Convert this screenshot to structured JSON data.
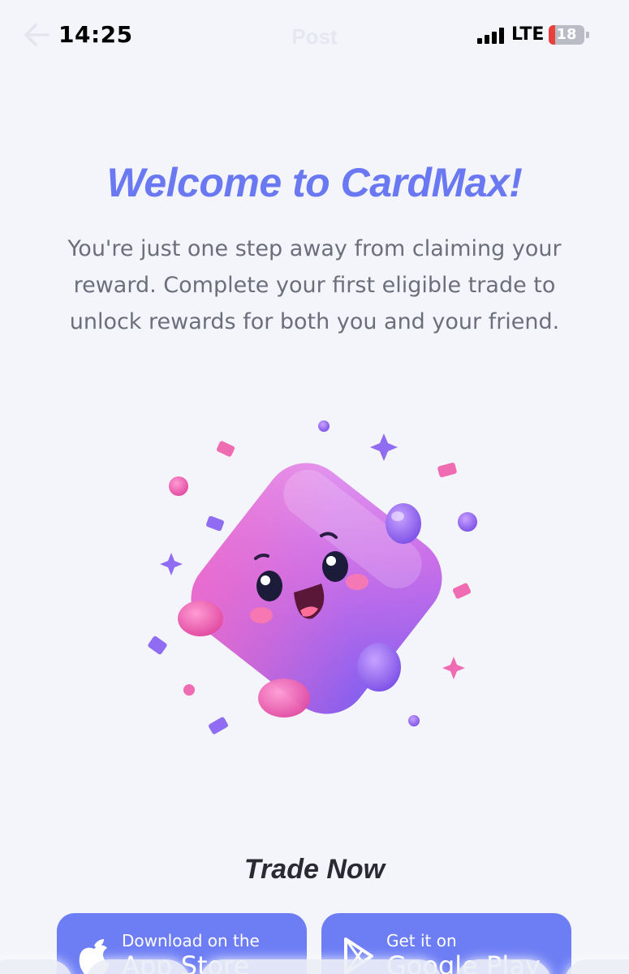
{
  "status_bar": {
    "time": "14:25",
    "network": "LTE",
    "battery": "18",
    "battery_level": 0.18
  },
  "nav": {
    "back_icon": "arrow-left-icon",
    "title": "Post"
  },
  "content": {
    "heading": "Welcome to CardMax!",
    "intro": "You're just one step away from claiming your reward. Complete your first eligible trade to unlock rewards for both you and your friend.",
    "mascot": "cute-purple-mascot-illustration",
    "trade_heading": "Trade Now"
  },
  "buttons": {
    "app_store": {
      "icon": "apple-icon",
      "small": "Download on the",
      "big": "App Store"
    },
    "google_play": {
      "icon": "google-play-icon",
      "small": "Get it on",
      "big": "Google Play"
    }
  },
  "colors": {
    "accent": "#6a78f2",
    "button": "#6d7ef5",
    "background": "#f4f5fa",
    "body_text": "#6b6f7b",
    "battery_low": "#e8403a"
  }
}
